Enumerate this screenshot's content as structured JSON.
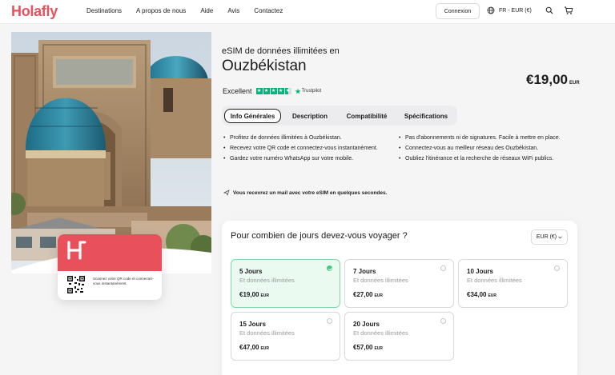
{
  "brand": {
    "logo": "Holafly",
    "accent": "#e8505b"
  },
  "nav": {
    "items": [
      "Destinations",
      "A propos de nous",
      "Aide",
      "Avis",
      "Contactez"
    ]
  },
  "header": {
    "login": "Connexion",
    "lang_currency": "FR - EUR (€)",
    "icons": [
      "globe-icon",
      "search-icon",
      "cart-icon"
    ]
  },
  "card": {
    "text": "Scannez votre QR code et connectez-vous instantanément."
  },
  "product": {
    "subtitle": "eSIM de données illimitées en",
    "title": "Ouzbékistan",
    "price": "€19,00",
    "price_unit": "EUR",
    "rating_label": "Excellent",
    "rating_stars": 4.5,
    "trustpilot": "Trustpilot"
  },
  "tabs": [
    {
      "label": "Info Générales",
      "active": true
    },
    {
      "label": "Description",
      "active": false
    },
    {
      "label": "Compatibilité",
      "active": false
    },
    {
      "label": "Spécifications",
      "active": false
    }
  ],
  "bullets_left": [
    "Profitez de données illimitées à Ouzbékistan.",
    "Recevez votre QR code et connectez-vous instantanément.",
    "Gardez votre numéro WhatsApp sur votre mobile."
  ],
  "bullets_right": [
    "Pas d'abonnements ni de signatures. Facile à mettre en place.",
    "Connectez-vous au meilleur réseau des Ouzbékistan.",
    "Oubliez l'itinérance et la recherche de réseaux WiFi publics."
  ],
  "note": "Vous recevrez un mail avec votre eSIM en quelques secondes.",
  "days": {
    "question": "Pour combien de jours devez-vous voyager ?",
    "currency": "EUR (€)",
    "options": [
      {
        "days": "5 Jours",
        "sub": "Et données illimitées",
        "price": "€19,00",
        "unit": "EUR",
        "selected": true
      },
      {
        "days": "7 Jours",
        "sub": "Et données illimitées",
        "price": "€27,00",
        "unit": "EUR",
        "selected": false
      },
      {
        "days": "10 Jours",
        "sub": "Et données illimitées",
        "price": "€34,00",
        "unit": "EUR",
        "selected": false
      },
      {
        "days": "15 Jours",
        "sub": "Et données illimitées",
        "price": "€47,00",
        "unit": "EUR",
        "selected": false
      },
      {
        "days": "20 Jours",
        "sub": "Et données illimitées",
        "price": "€57,00",
        "unit": "EUR",
        "selected": false
      }
    ]
  }
}
